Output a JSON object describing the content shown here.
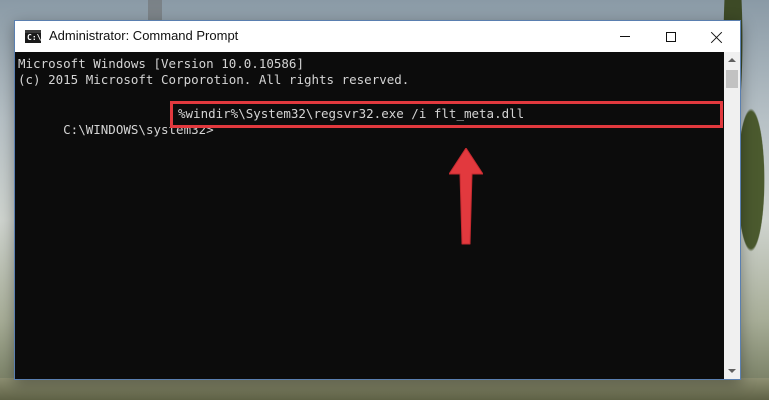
{
  "window": {
    "title": "Administrator: Command Prompt",
    "app_icon": "command-prompt-icon",
    "app_icon_glyph": "C:\\",
    "controls": [
      "minimize-icon",
      "maximize-icon",
      "close-icon"
    ]
  },
  "console": {
    "lines": [
      "Microsoft Windows [Version 10.0.10586]",
      "(c) 2015 Microsoft Corporotion. All rights reserved."
    ],
    "prompt": "C:\\WINDOWS\\system32>",
    "command": "%windir%\\System32\\regsvr32.exe /i flt_meta.dll",
    "text_color": "#d4d4d4",
    "background_color": "#0c0c0c"
  },
  "annotation": {
    "highlight_color": "#e2393e",
    "arrow_icon": "up-arrow-icon"
  },
  "scrollbar": {
    "up_icon": "scroll-up-arrow-icon",
    "down_icon": "scroll-down-arrow-icon"
  }
}
